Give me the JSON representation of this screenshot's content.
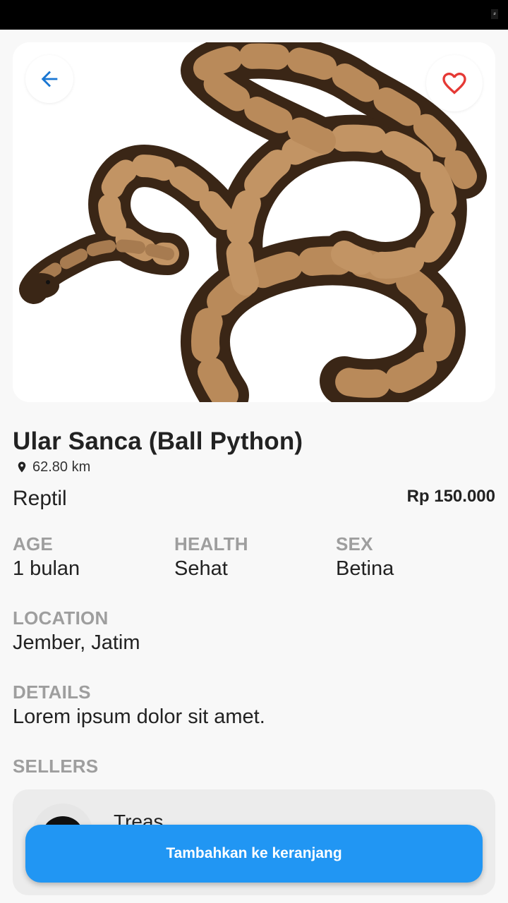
{
  "status_bar": {
    "glyph": "⸗"
  },
  "product": {
    "title": "Ular Sanca (Ball Python)",
    "distance": "62.80 km",
    "category": "Reptil",
    "price": "Rp 150.000"
  },
  "attributes": {
    "age_label": "AGE",
    "age_value": "1 bulan",
    "health_label": "HEALTH",
    "health_value": "Sehat",
    "sex_label": "SEX",
    "sex_value": "Betina",
    "location_label": "LOCATION",
    "location_value": "Jember, Jatim",
    "details_label": "DETAILS",
    "details_value": "Lorem ipsum dolor sit amet.",
    "sellers_label": "SELLERS"
  },
  "seller": {
    "name": "Treas"
  },
  "actions": {
    "add_to_cart": "Tambahkan ke keranjang"
  },
  "icons": {
    "back": "arrow-left-icon",
    "favorite": "heart-outline-icon",
    "location": "map-pin-icon"
  },
  "colors": {
    "accent": "#2196f3",
    "back_arrow": "#1976d2",
    "heart": "#e53935",
    "label_gray": "#9e9e9e"
  }
}
